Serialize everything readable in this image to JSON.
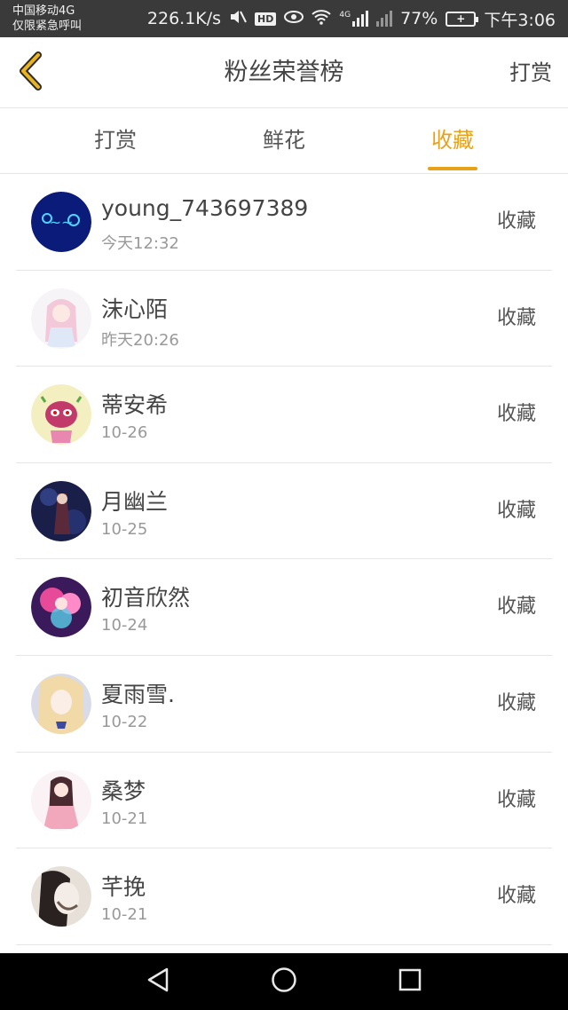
{
  "status_bar": {
    "carrier_line1": "中国移动4G",
    "carrier_line2": "仅限紧急呼叫",
    "net_speed": "226.1K/s",
    "battery_percent": "77%",
    "time": "下午3:06",
    "hd_label": "HD",
    "net_type": "4G",
    "icons": [
      "mute-icon",
      "hd-icon",
      "eye-icon",
      "wifi-icon",
      "signal-icon",
      "battery-icon"
    ]
  },
  "header": {
    "title": "粉丝荣誉榜",
    "action_label": "打赏",
    "back_icon": "chevron-left-icon",
    "accent_color": "#e8a21a"
  },
  "tabs": [
    {
      "label": "打赏",
      "active": false
    },
    {
      "label": "鲜花",
      "active": false
    },
    {
      "label": "收藏",
      "active": true
    }
  ],
  "list": [
    {
      "name": "young_743697389",
      "time": "今天12:32",
      "action": "收藏"
    },
    {
      "name": "沫心陌",
      "time": "昨天20:26",
      "action": "收藏"
    },
    {
      "name": "蒂安希",
      "time": "10-26",
      "action": "收藏"
    },
    {
      "name": "月幽兰",
      "time": "10-25",
      "action": "收藏"
    },
    {
      "name": "初音欣然",
      "time": "10-24",
      "action": "收藏"
    },
    {
      "name": "夏雨雪.",
      "time": "10-22",
      "action": "收藏"
    },
    {
      "name": "桑梦",
      "time": "10-21",
      "action": "收藏"
    },
    {
      "name": "芊挽",
      "time": "10-21",
      "action": "收藏"
    }
  ],
  "nav_bar": {
    "icons": [
      "back-triangle-icon",
      "home-circle-icon",
      "recents-square-icon"
    ]
  }
}
